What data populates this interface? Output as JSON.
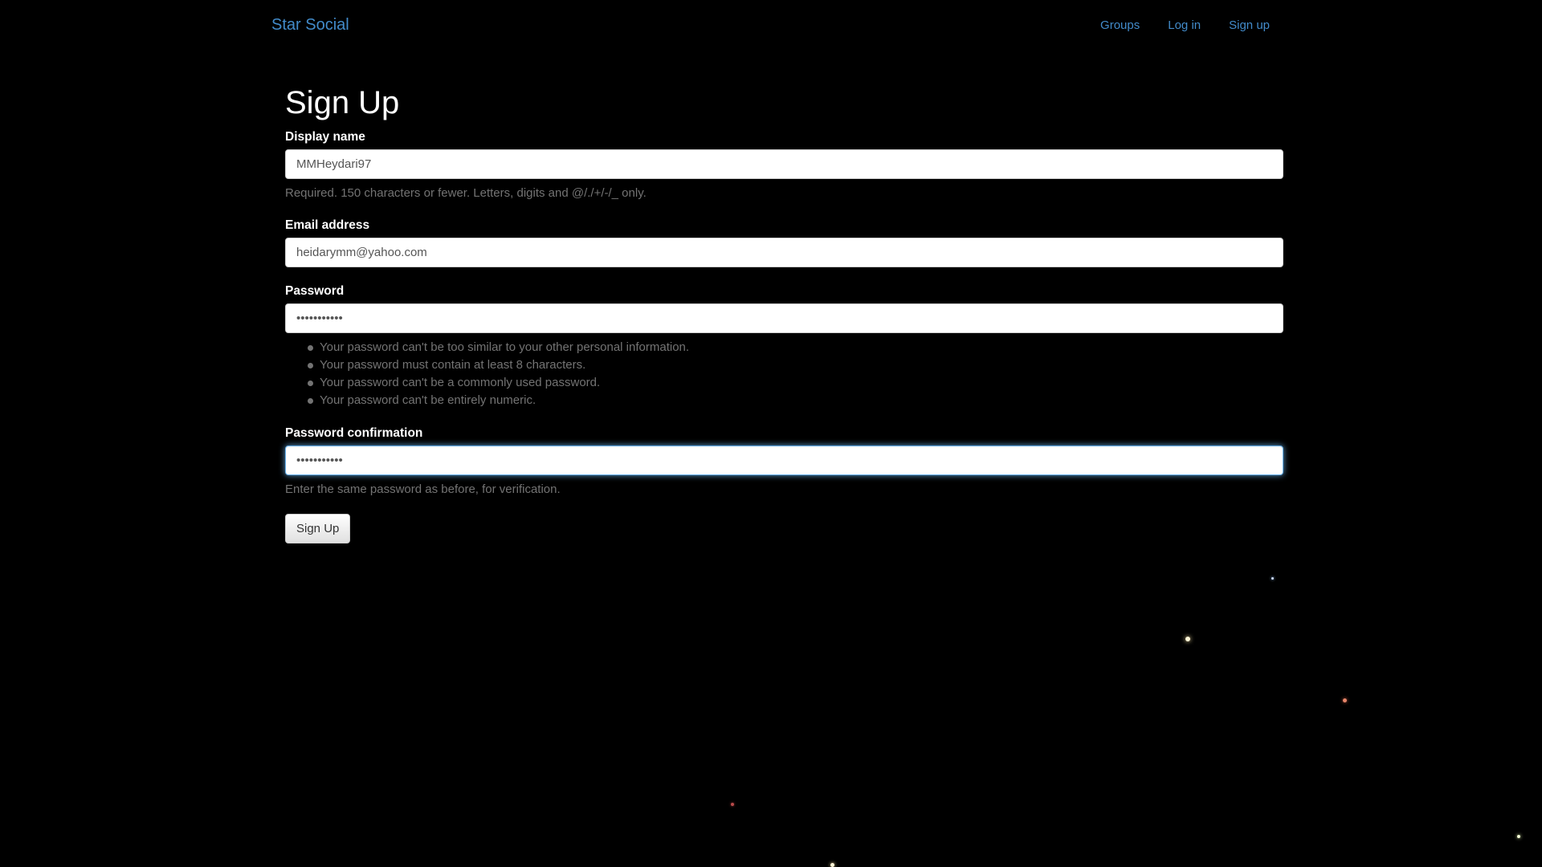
{
  "navbar": {
    "brand": "Star Social",
    "links": [
      "Groups",
      "Log in",
      "Sign up"
    ]
  },
  "form": {
    "title": "Sign Up",
    "display_name": {
      "label": "Display name",
      "value": "MMHeydari97",
      "help": "Required. 150 characters or fewer. Letters, digits and @/./+/-/_ only."
    },
    "email": {
      "label": "Email address",
      "value": "heidarymm@yahoo.com"
    },
    "password": {
      "label": "Password",
      "value": "•••••••••••",
      "rules": [
        "Your password can't be too similar to your other personal information.",
        "Your password must contain at least 8 characters.",
        "Your password can't be a commonly used password.",
        "Your password can't be entirely numeric."
      ]
    },
    "password_confirmation": {
      "label": "Password confirmation",
      "value": "•••••••••••",
      "help": "Enter the same password as before, for verification."
    },
    "submit_label": "Sign Up"
  },
  "colors": {
    "background": "#000000",
    "link": "#428bca",
    "help_text": "#737373",
    "focus_ring": "#66afe9"
  }
}
